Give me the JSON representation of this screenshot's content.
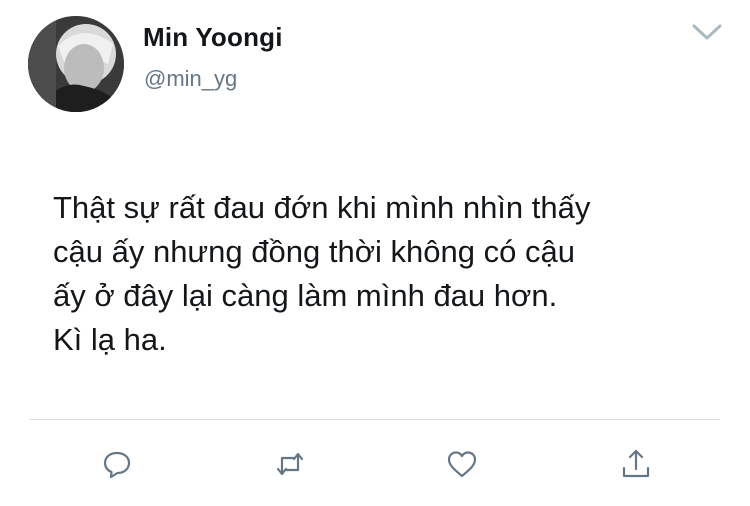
{
  "author": {
    "display_name": "Min Yoongi",
    "handle": "@min_yg"
  },
  "tweet": {
    "text": "Thật sự rất đau đớn khi mình nhìn thấy\ncậu ấy nhưng đồng thời không có cậu\nấy ở đây lại càng làm mình đau hơn.\nKì lạ ha."
  },
  "icons": {
    "caret": "chevron-down-icon",
    "reply": "reply-icon",
    "retweet": "retweet-icon",
    "like": "heart-icon",
    "share": "share-icon"
  },
  "colors": {
    "text": "#14171a",
    "secondary": "#657786",
    "icon": "#657786",
    "caret": "#aab8c2"
  }
}
